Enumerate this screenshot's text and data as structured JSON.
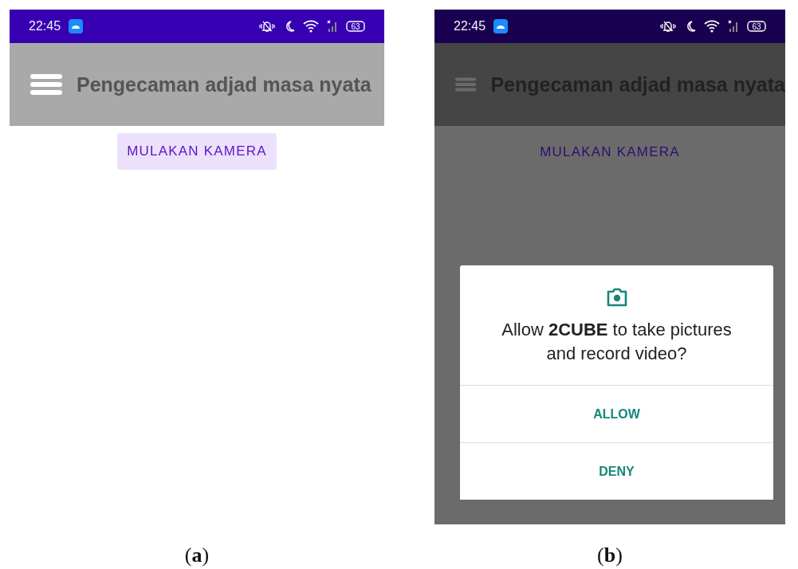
{
  "screens": [
    {
      "status_bar": {
        "time": "22:45",
        "battery": "63"
      },
      "app_bar": {
        "title": "Pengecaman adjad masa nyata"
      },
      "start_button": "MULAKAN KAMERA",
      "dimmed": false,
      "caption": "(**a**)"
    },
    {
      "status_bar": {
        "time": "22:45",
        "battery": "63"
      },
      "app_bar": {
        "title": "Pengecaman adjad masa nyata"
      },
      "start_button": "MULAKAN KAMERA",
      "dimmed": true,
      "dialog": {
        "message": "Allow **2CUBE** to take pictures and record video?",
        "buttons": [
          "ALLOW",
          "DENY"
        ]
      },
      "caption": "(**b**)"
    }
  ]
}
